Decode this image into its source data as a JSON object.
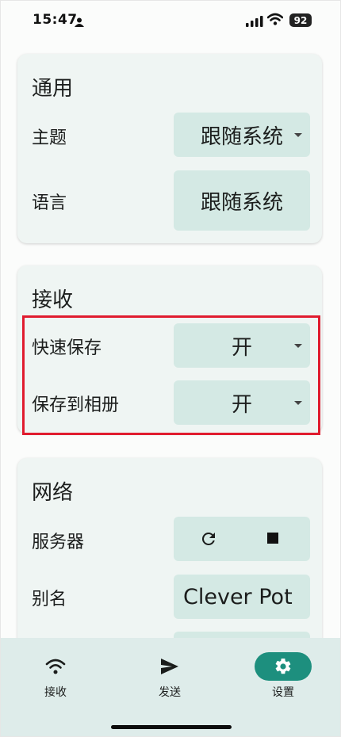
{
  "status_bar": {
    "time": "15:47",
    "battery": "92"
  },
  "general": {
    "title": "通用",
    "theme_label": "主题",
    "theme_value": "跟随系统",
    "language_label": "语言",
    "language_value": "跟随系统"
  },
  "receive": {
    "title": "接收",
    "quick_save_label": "快速保存",
    "quick_save_value": "开",
    "save_to_album_label": "保存到相册",
    "save_to_album_value": "开"
  },
  "network": {
    "title": "网络",
    "server_label": "服务器",
    "alias_label": "别名",
    "alias_value": "Clever Pot"
  },
  "nav": {
    "items": [
      {
        "label": "接收",
        "icon": "wifi-icon"
      },
      {
        "label": "发送",
        "icon": "send-icon"
      },
      {
        "label": "设置",
        "icon": "gear-icon"
      }
    ],
    "active_color": "#1d8f7e"
  },
  "colors": {
    "card": "#eff5f3",
    "control": "#d4e9e4",
    "highlight": "#e01b2e"
  }
}
